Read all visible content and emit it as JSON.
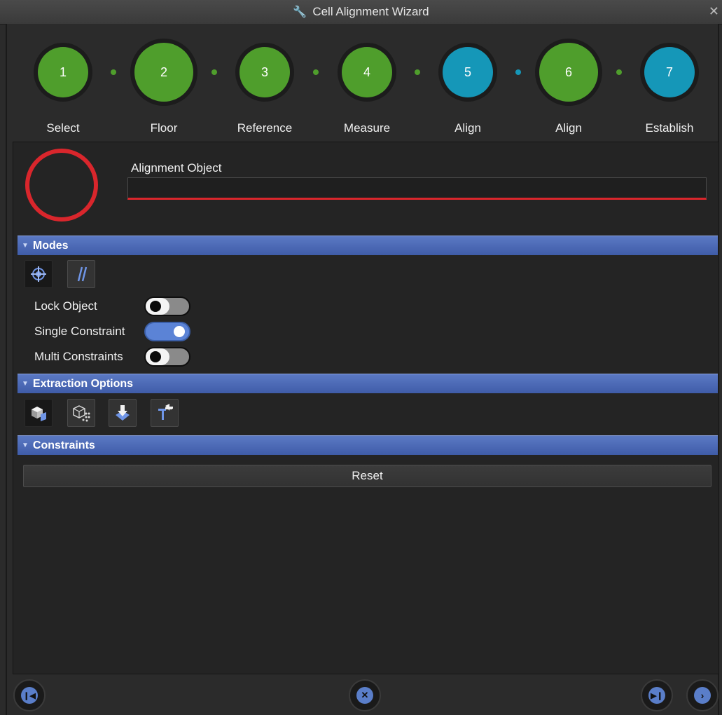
{
  "window": {
    "title": "Cell Alignment Wizard"
  },
  "steps": [
    {
      "num": "1",
      "label": "Select",
      "color": "#4f9e2c"
    },
    {
      "num": "2",
      "label": "Floor",
      "color": "#4f9e2c"
    },
    {
      "num": "3",
      "label": "Reference",
      "color": "#4f9e2c"
    },
    {
      "num": "4",
      "label": "Measure",
      "color": "#4f9e2c"
    },
    {
      "num": "5",
      "label": "Align",
      "color": "#1597b8"
    },
    {
      "num": "6",
      "label": "Align",
      "color": "#4f9e2c"
    },
    {
      "num": "7",
      "label": "Establish",
      "color": "#1597b8"
    }
  ],
  "alignment": {
    "label": "Alignment Object",
    "value": ""
  },
  "sections": {
    "modes": "Modes",
    "extraction": "Extraction Options",
    "constraints": "Constraints"
  },
  "toggles": [
    {
      "label": "Lock Object",
      "state": "off"
    },
    {
      "label": "Single Constraint",
      "state": "on"
    },
    {
      "label": "Multi Constraints",
      "state": "off"
    }
  ],
  "reset_label": "Reset",
  "colors": {
    "accent": "#4a6bbd",
    "error": "#d9262c",
    "step_green": "#4f9e2c",
    "step_blue": "#1597b8"
  }
}
